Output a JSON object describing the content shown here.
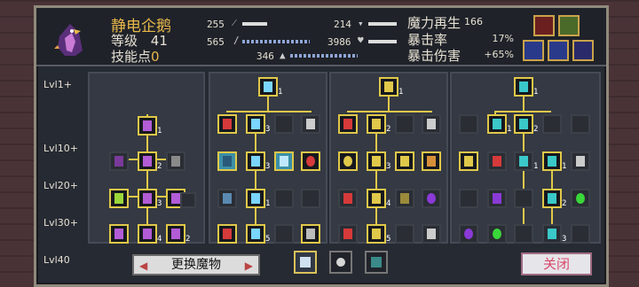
{
  "header": {
    "name": "静电企鹅",
    "level_label": "等级",
    "level_value": "41",
    "sp_label": "技能点",
    "sp_value": "0",
    "stats": [
      {
        "value": "255",
        "icon": "sword-icon"
      },
      {
        "value": "565",
        "icon": "staff-icon"
      },
      {
        "value": "214",
        "icon": "shield-icon"
      },
      {
        "value": "3986",
        "icon": "heart-icon"
      },
      {
        "value": "346",
        "icon": "mana-icon"
      }
    ],
    "regen_label": "魔力再生",
    "regen_value": "166",
    "crit_label": "暴击率",
    "crit_value": "17%",
    "critdmg_label": "暴击伤害",
    "critdmg_value": "+65%"
  },
  "levels": [
    "Lvl1+",
    "Lvl10+",
    "Lvl20+",
    "Lvl30+",
    "Lvl40"
  ],
  "nodes": [
    {
      "n": "1"
    },
    {
      "n": "1"
    },
    {
      "n": "1"
    },
    {
      "n": "1"
    },
    {
      "n": "1"
    },
    {
      "n": "3"
    },
    {
      "n": "2"
    },
    {
      "n": "2"
    },
    {
      "n": "2"
    },
    {
      "n": "3"
    },
    {
      "n": "3"
    },
    {
      "n": "1"
    },
    {
      "n": "1"
    },
    {
      "n": "3"
    },
    {
      "n": "1"
    },
    {
      "n": "1"
    },
    {
      "n": "2"
    },
    {
      "n": "4"
    },
    {
      "n": "4"
    },
    {
      "n": "2"
    },
    {
      "n": "5"
    },
    {
      "n": "5"
    },
    {
      "n": "3"
    }
  ],
  "buttons": {
    "change": "更换魔物",
    "close": "关闭"
  }
}
